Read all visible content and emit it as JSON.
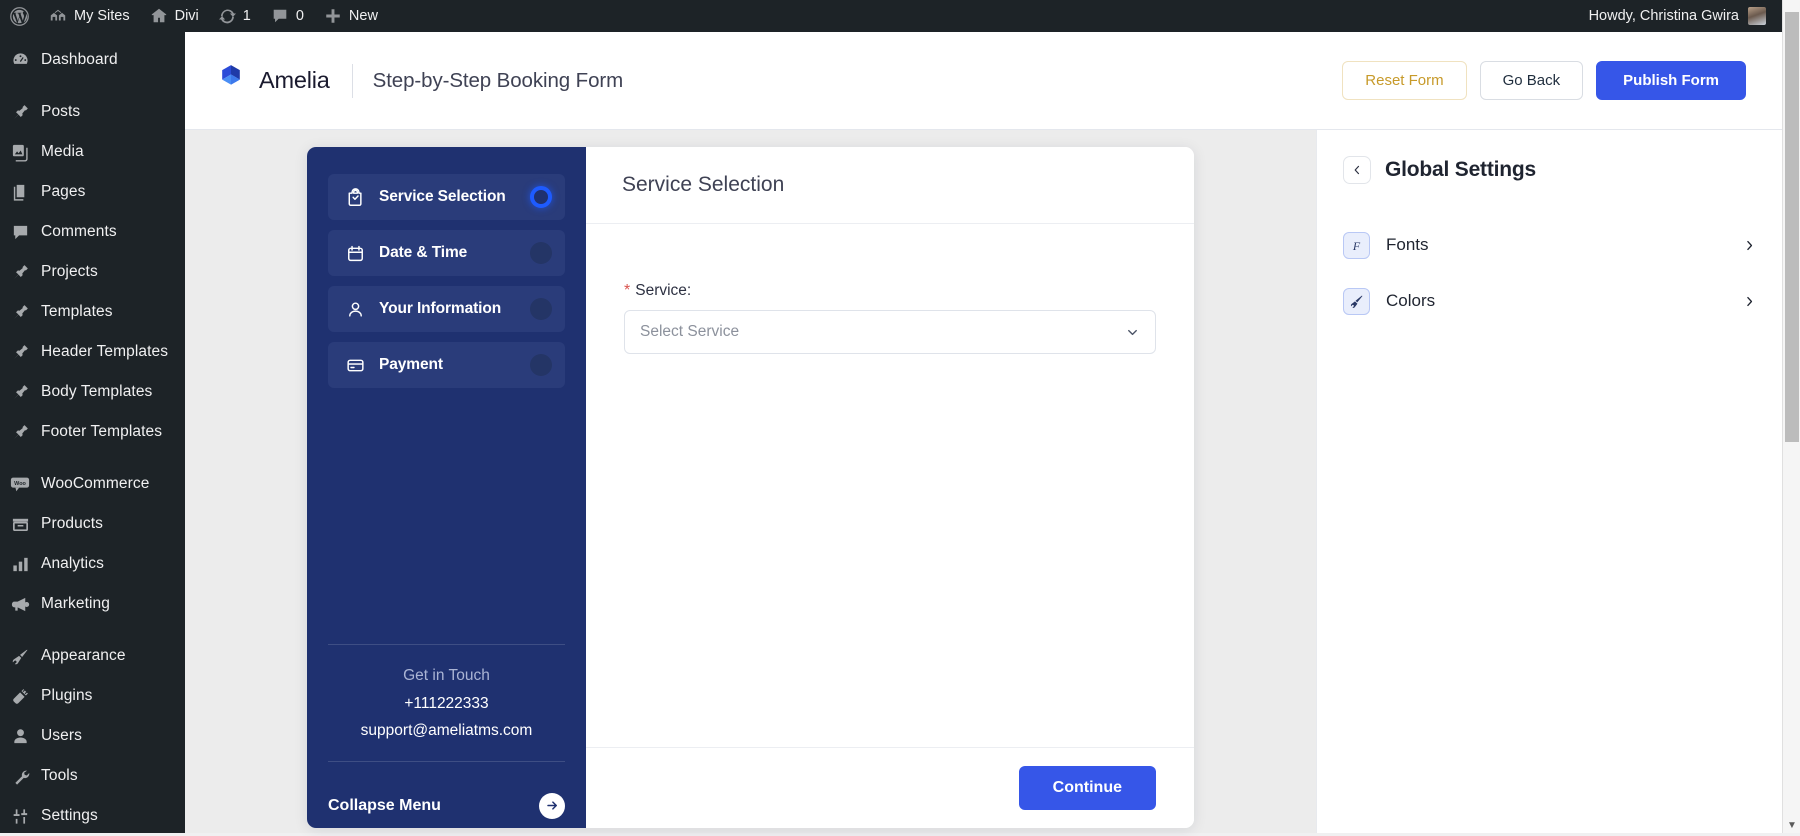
{
  "adminbar": {
    "items": [
      {
        "icon": "wordpress-icon",
        "label": ""
      },
      {
        "icon": "my-sites-icon",
        "label": "My Sites"
      },
      {
        "icon": "home-icon",
        "label": "Divi"
      },
      {
        "icon": "updates-icon",
        "label": "1"
      },
      {
        "icon": "comments-icon",
        "label": "0"
      },
      {
        "icon": "plus-icon",
        "label": "New"
      }
    ],
    "howdy": "Howdy, Christina Gwira"
  },
  "sidebar": {
    "items": [
      {
        "icon": "dashboard-icon",
        "label": "Dashboard"
      },
      {
        "icon": "posts-pin-icon",
        "label": "Posts"
      },
      {
        "icon": "media-icon",
        "label": "Media"
      },
      {
        "icon": "pages-icon",
        "label": "Pages"
      },
      {
        "icon": "comments-icon",
        "label": "Comments"
      },
      {
        "icon": "projects-pin-icon",
        "label": "Projects"
      },
      {
        "icon": "templates-pin-icon",
        "label": "Templates"
      },
      {
        "icon": "header-templates-pin-icon",
        "label": "Header Templates"
      },
      {
        "icon": "body-templates-pin-icon",
        "label": "Body Templates"
      },
      {
        "icon": "footer-templates-pin-icon",
        "label": "Footer Templates"
      },
      {
        "icon": "woocommerce-icon",
        "label": "WooCommerce"
      },
      {
        "icon": "products-icon",
        "label": "Products"
      },
      {
        "icon": "analytics-icon",
        "label": "Analytics"
      },
      {
        "icon": "marketing-icon",
        "label": "Marketing"
      },
      {
        "icon": "appearance-icon",
        "label": "Appearance"
      },
      {
        "icon": "plugins-icon",
        "label": "Plugins"
      },
      {
        "icon": "users-icon",
        "label": "Users"
      },
      {
        "icon": "tools-icon",
        "label": "Tools"
      },
      {
        "icon": "settings-icon",
        "label": "Settings"
      }
    ]
  },
  "header": {
    "brand": "Amelia",
    "page_title": "Step-by-Step Booking Form",
    "reset_label": "Reset Form",
    "goback_label": "Go Back",
    "publish_label": "Publish Form"
  },
  "booking_form": {
    "steps": [
      {
        "icon": "service-bag-icon",
        "label": "Service Selection",
        "state": "active"
      },
      {
        "icon": "calendar-icon",
        "label": "Date & Time",
        "state": "inactive"
      },
      {
        "icon": "user-icon",
        "label": "Your Information",
        "state": "inactive"
      },
      {
        "icon": "credit-card-icon",
        "label": "Payment",
        "state": "inactive"
      }
    ],
    "get_in_touch": {
      "title": "Get in Touch",
      "phone": "+111222333",
      "email": "support@ameliatms.com"
    },
    "collapse_label": "Collapse Menu",
    "panel_title": "Service Selection",
    "service_field": {
      "label": "Service:",
      "required_marker": "*",
      "placeholder": "Select Service",
      "value": ""
    },
    "continue_label": "Continue"
  },
  "settings": {
    "title": "Global Settings",
    "back_icon": "chevron-left-icon",
    "rows": [
      {
        "icon": "fonts-icon",
        "label": "Fonts",
        "chevron": "chevron-right-icon"
      },
      {
        "icon": "colors-brush-icon",
        "label": "Colors",
        "chevron": "chevron-right-icon"
      }
    ]
  },
  "colors": {
    "wp_dark": "#1d2327",
    "amelia_primary": "#3656e8",
    "stepper_bg": "#1f3170",
    "step_row_bg": "#2a3c7a",
    "active_ring": "#1e5bff",
    "reset_text": "#c79a2a",
    "required_star": "#d9544f"
  }
}
